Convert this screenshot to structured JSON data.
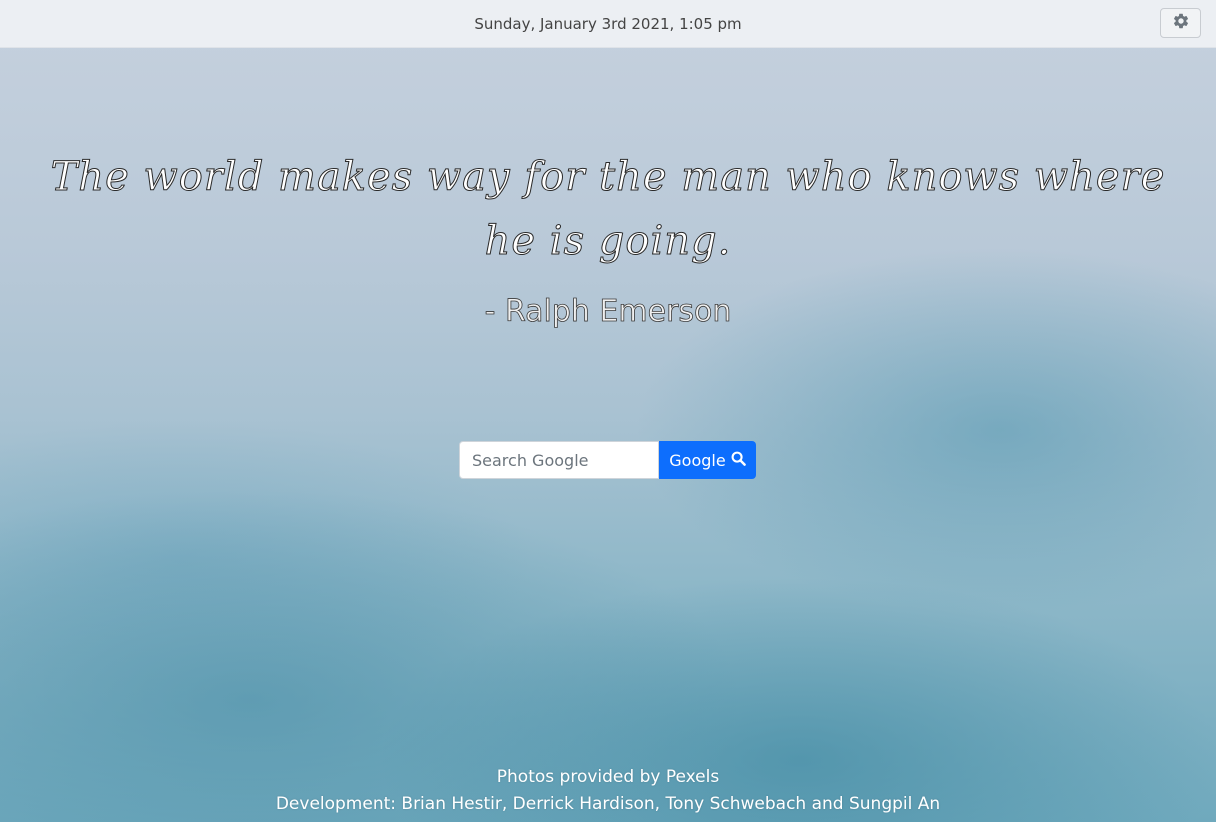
{
  "header": {
    "datetime": "Sunday, January 3rd 2021, 1:05 pm",
    "settings_icon": "gear-icon"
  },
  "quote": {
    "text": "The world makes way for the man who knows where he is going.",
    "author": "- Ralph Emerson"
  },
  "search": {
    "placeholder": "Search Google",
    "value": "",
    "button_label": "Google",
    "button_icon": "search-icon",
    "button_color": "#0d6efd"
  },
  "footer": {
    "photos_credit": "Photos provided by Pexels",
    "development_credit": "Development: Brian Hestir, Derrick Hardison, Tony Schwebach and Sungpil An"
  }
}
